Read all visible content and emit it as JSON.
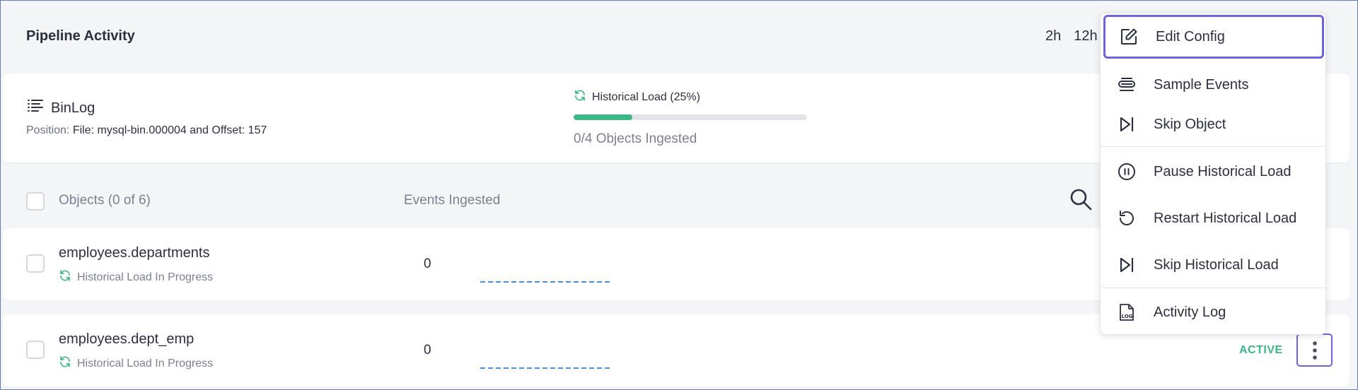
{
  "header": {
    "title": "Pipeline Activity",
    "time_ranges": [
      "2h",
      "12h"
    ]
  },
  "binlog": {
    "title": "BinLog",
    "position_label": "Position:",
    "position_value": "File: mysql-bin.000004 and Offset: 157",
    "historical_status": "Historical Load (25%)",
    "progress_fraction": 0.25,
    "objects_ingested": "0/4 Objects Ingested"
  },
  "list": {
    "objects_header": "Objects (0 of 6)",
    "events_header": "Events Ingested",
    "rows": [
      {
        "name": "employees.departments",
        "status": "Historical Load In Progress",
        "events": "0"
      },
      {
        "name": "employees.dept_emp",
        "status": "Historical Load In Progress",
        "events": "0",
        "badge": "ACTIVE"
      }
    ]
  },
  "menu": {
    "items": [
      {
        "label": "Edit Config",
        "icon": "edit-icon"
      },
      {
        "label": "Sample Events",
        "icon": "sample-events-icon"
      },
      {
        "label": "Skip Object",
        "icon": "skip-icon"
      },
      {
        "label": "Pause Historical Load",
        "icon": "pause-icon"
      },
      {
        "label": "Restart Historical Load",
        "icon": "restart-icon"
      },
      {
        "label": "Skip Historical Load",
        "icon": "skip-icon"
      },
      {
        "label": "Activity Log",
        "icon": "log-file-icon"
      }
    ]
  },
  "colors": {
    "accent": "#6e62e0",
    "success": "#3bb885",
    "sparkline": "#4a90d9"
  }
}
